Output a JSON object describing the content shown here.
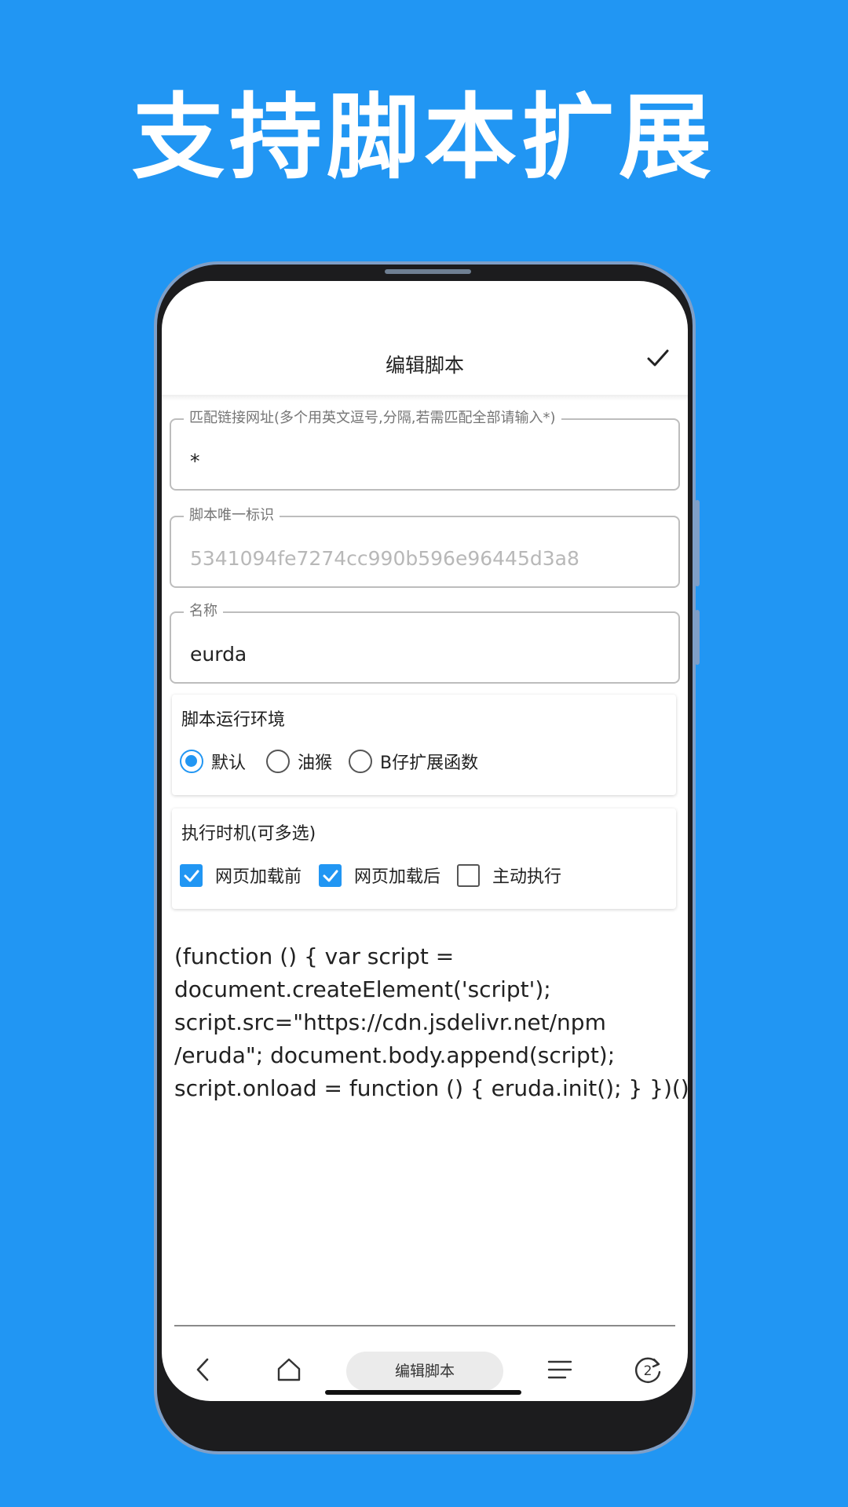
{
  "headline": "支持脚本扩展",
  "appbar": {
    "title": "编辑脚本",
    "confirm_icon": "check-icon"
  },
  "form": {
    "match_url": {
      "label": "匹配链接网址(多个用英文逗号,分隔,若需匹配全部请输入*)",
      "value": "*"
    },
    "script_id": {
      "label": "脚本唯一标识",
      "value": "5341094fe7274cc990b596e96445d3a8"
    },
    "name": {
      "label": "名称",
      "value": "eurda"
    }
  },
  "runtime": {
    "title": "脚本运行环境",
    "options": [
      {
        "label": "默认",
        "selected": true
      },
      {
        "label": "油猴",
        "selected": false
      },
      {
        "label": "B仔扩展函数",
        "selected": false
      }
    ]
  },
  "timing": {
    "title": "执行时机(可多选)",
    "options": [
      {
        "label": "网页加载前",
        "checked": true
      },
      {
        "label": "网页加载后",
        "checked": true
      },
      {
        "label": "主动执行",
        "checked": false
      }
    ]
  },
  "code_lines": [
    "(function () { var script =",
    "document.createElement('script');",
    "script.src=\"https://cdn.jsdelivr.net/npm",
    "/eruda\"; document.body.append(script);",
    "script.onload = function () { eruda.init(); } })();"
  ],
  "bottom_nav": {
    "back_icon": "chevron-left-icon",
    "home_icon": "home-icon",
    "current_tab": "编辑脚本",
    "menu_icon": "menu-icon",
    "tabs_icon": "tab-count-icon",
    "tab_count": "2"
  },
  "colors": {
    "background": "#2196F3",
    "accent": "#2196F3"
  }
}
